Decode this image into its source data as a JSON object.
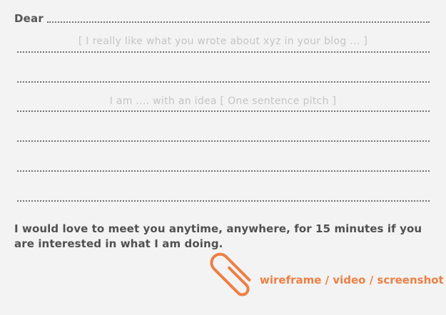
{
  "letter": {
    "salutation": "Dear",
    "hint_blog": "[ I really like what you wrote about xyz in your blog ... ]",
    "hint_pitch": "I am ....  with an idea   [ One sentence pitch ]",
    "closing": "I would love to meet you anytime, anywhere, for 15 minutes if you are interested in what I am doing.",
    "attachment_label": "wireframe / video / screenshot"
  },
  "icons": {
    "attachment": "paperclip-icon"
  },
  "colors": {
    "background": "#f3f3f3",
    "text": "#555555",
    "hint": "#c4c4c4",
    "accent": "#ee7f45",
    "rule": "#707070"
  }
}
